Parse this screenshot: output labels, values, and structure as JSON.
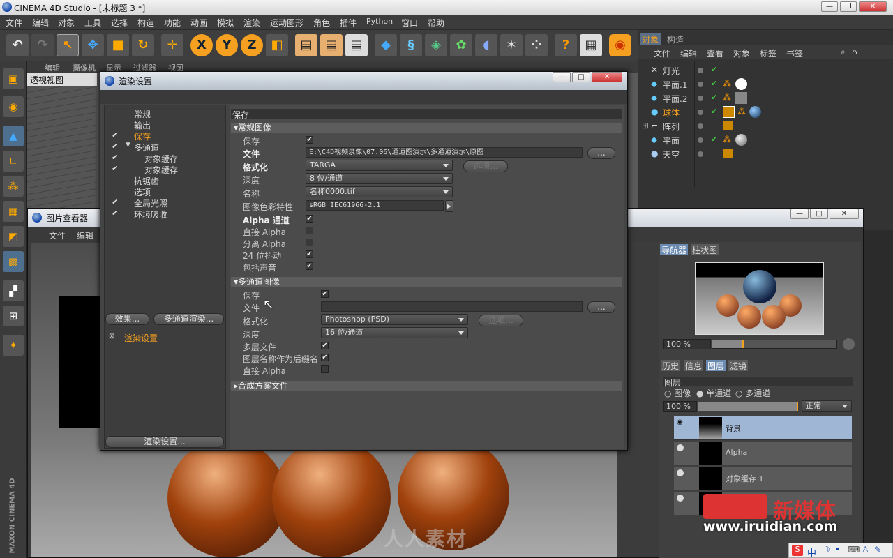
{
  "app": {
    "title": "CINEMA 4D Studio - [未标题 3 *]",
    "menu": [
      "文件",
      "编辑",
      "对象",
      "工具",
      "选择",
      "构造",
      "功能",
      "动画",
      "模拟",
      "渲染",
      "运动图形",
      "角色",
      "插件",
      "Python",
      "窗口",
      "帮助"
    ]
  },
  "viewport": {
    "menu": [
      "编辑",
      "摄像机",
      "显示",
      "过滤器",
      "视图"
    ],
    "label": "透视视图",
    "side_label": "MAXON CINEMA 4D"
  },
  "object_manager": {
    "tabs": [
      "对象",
      "构造"
    ],
    "menu": [
      "文件",
      "编辑",
      "查看",
      "对象",
      "标签",
      "书签"
    ],
    "objects": [
      {
        "name": "灯光",
        "icon": "light-icon"
      },
      {
        "name": "平面.1",
        "icon": "plane-icon"
      },
      {
        "name": "平面.2",
        "icon": "plane-icon"
      },
      {
        "name": "球体",
        "icon": "sphere-icon",
        "selected": true
      },
      {
        "name": "阵列",
        "icon": "array-icon"
      },
      {
        "name": "平面",
        "icon": "plane-icon"
      },
      {
        "name": "天空",
        "icon": "sky-icon"
      }
    ]
  },
  "render_settings": {
    "title": "渲染设置",
    "nav": [
      {
        "label": "常规",
        "checked": false,
        "indent": 0
      },
      {
        "label": "输出",
        "checked": false,
        "indent": 0
      },
      {
        "label": "保存",
        "checked": true,
        "indent": 0,
        "selected": true
      },
      {
        "label": "多通道",
        "checked": true,
        "indent": 0
      },
      {
        "label": "对象缓存",
        "checked": true,
        "indent": 1
      },
      {
        "label": "对象缓存",
        "checked": true,
        "indent": 1
      },
      {
        "label": "抗锯齿",
        "checked": false,
        "indent": 0
      },
      {
        "label": "选项",
        "checked": false,
        "indent": 0
      },
      {
        "label": "全局光照",
        "checked": true,
        "indent": 0
      },
      {
        "label": "环境吸收",
        "checked": true,
        "indent": 0
      }
    ],
    "effects_button": "效果...",
    "multipass_button": "多通道渲染...",
    "preset_label": "渲染设置",
    "bottom_button": "渲染设置...",
    "header": "保存",
    "regular_section": "常规图像",
    "save_label": "保存",
    "file_label": "文件",
    "file_value": "E:\\C4D视频录像\\07.06\\通道图演示\\多通道演示\\原图",
    "browse": "...",
    "format_label": "格式化",
    "format_value": "TARGA",
    "options_button": "选项...",
    "depth_label": "深度",
    "depth_value": "8 位/通道",
    "name_label": "名称",
    "name_value": "名称0000.tif",
    "color_profile_label": "图像色彩特性",
    "color_profile_value": "sRGB IEC61966-2.1",
    "alpha_label": "Alpha 通道",
    "straight_alpha_label": "直接 Alpha",
    "separate_alpha_label": "分离 Alpha",
    "dither_label": "24 位抖动",
    "sound_label": "包括声音",
    "multipass_section": "多通道图像",
    "mp_save_label": "保存",
    "mp_file_label": "文件",
    "mp_format_label": "格式化",
    "mp_format_value": "Photoshop (PSD)",
    "mp_depth_label": "深度",
    "mp_depth_value": "16 位/通道",
    "mp_layer_file_label": "多层文件",
    "mp_layer_suffix_label": "图层名称作为后缀名",
    "mp_straight_alpha_label": "直接 Alpha",
    "composite_section": "合成方案文件"
  },
  "picture_viewer": {
    "title": "图片查看器",
    "menu": [
      "文件",
      "编辑"
    ],
    "nav_tabs": [
      "导航器",
      "柱状图"
    ],
    "zoom": "100 %",
    "info_tabs": [
      "历史",
      "信息",
      "图层",
      "滤镜"
    ],
    "layers_label": "图层",
    "layer_modes": [
      "图像",
      "单通道",
      "多通道"
    ],
    "opacity": "100 %",
    "blend_mode": "正常",
    "layers": [
      "背景",
      "Alpha",
      "对象缓存 1",
      ""
    ]
  },
  "watermarks": {
    "center": "人人素材",
    "logo": "新媒体",
    "url": "www.iruidian.com"
  },
  "taskbar_ime": "中"
}
